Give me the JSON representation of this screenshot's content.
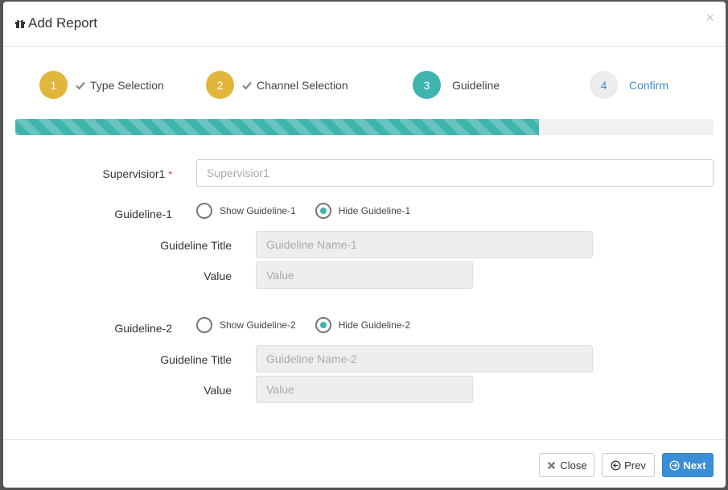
{
  "modal": {
    "title": "Add Report",
    "close_glyph": "×"
  },
  "steps": [
    {
      "number": "1",
      "label": "Type Selection",
      "state": "done"
    },
    {
      "number": "2",
      "label": "Channel Selection",
      "state": "done"
    },
    {
      "number": "3",
      "label": "Guideline",
      "state": "active"
    },
    {
      "number": "4",
      "label": "Confirm",
      "state": "todo"
    }
  ],
  "progress": {
    "percent": 75
  },
  "form": {
    "supervisior": {
      "label": "Supervisior1",
      "required_mark": "*",
      "placeholder": "Supervisior1",
      "value": ""
    },
    "guideline1": {
      "label": "Guideline-1",
      "show_label": "Show Guideline-1",
      "hide_label": "Hide Guideline-1",
      "selected": "hide",
      "title_label": "Guideline Title",
      "title_placeholder": "Guideline Name-1",
      "value_label": "Value",
      "value_placeholder": "Value"
    },
    "guideline2": {
      "label": "Guideline-2",
      "show_label": "Show Guideline-2",
      "hide_label": "Hide Guideline-2",
      "selected": "hide",
      "title_label": "Guideline Title",
      "title_placeholder": "Guideline Name-2",
      "value_label": "Value",
      "value_placeholder": "Value"
    }
  },
  "footer": {
    "close_label": "Close",
    "prev_label": "Prev",
    "next_label": "Next"
  },
  "colors": {
    "step_done": "#e1b63b",
    "step_active": "#3fb4ad",
    "link_blue": "#3f8cd0",
    "primary": "#3a8fd8"
  },
  "icons": {
    "title": "gift-icon",
    "step_done": "check-icon",
    "close": "times-icon",
    "prev": "arrow-circle-left-icon",
    "next": "arrow-circle-right-icon"
  }
}
